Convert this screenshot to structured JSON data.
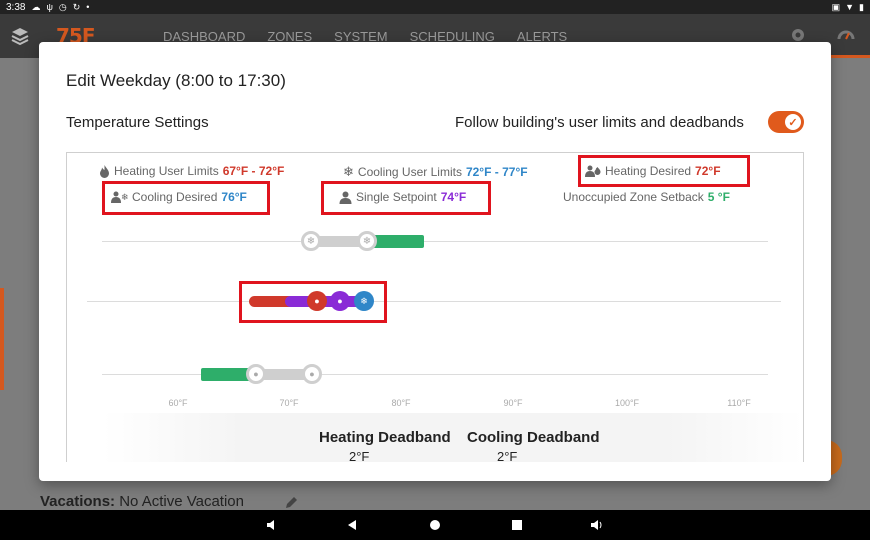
{
  "status": {
    "time": "3:38"
  },
  "app": {
    "logo": "75F",
    "nav": [
      "DASHBOARD",
      "ZONES",
      "SYSTEM",
      "SCHEDULING",
      "ALERTS"
    ]
  },
  "background": {
    "vacations_label": "Vacations:",
    "vacations_value": "No Active Vacation"
  },
  "modal": {
    "title": "Edit Weekday (8:00 to 17:30)",
    "section_title": "Temperature Settings",
    "follow_label": "Follow building's user limits and deadbands",
    "follow_enabled": true,
    "legend": {
      "heating_limits_label": "Heating User Limits",
      "heating_limits_value": "67°F - 72°F",
      "cooling_limits_label": "Cooling User Limits",
      "cooling_limits_value": "72°F - 77°F",
      "heating_desired_label": "Heating Desired",
      "heating_desired_value": "72°F",
      "cooling_desired_label": "Cooling Desired",
      "cooling_desired_value": "76°F",
      "single_setpoint_label": "Single Setpoint",
      "single_setpoint_value": "74°F",
      "unoccupied_label": "Unoccupied Zone Setback",
      "unoccupied_value": "5 °F"
    },
    "axis_ticks": [
      "60°F",
      "70°F",
      "80°F",
      "90°F",
      "100°F",
      "110°F"
    ],
    "deadband": {
      "heating_label": "Heating Deadband",
      "heating_value": "2°F",
      "cooling_label": "Cooling Deadband",
      "cooling_value": "2°F"
    }
  },
  "colors": {
    "accent": "#e05a1c",
    "heating": "#d0392b",
    "cooling": "#2f86c8",
    "setpoint": "#8a2bd6",
    "setback": "#2eae6a",
    "highlight": "#e0141e"
  }
}
